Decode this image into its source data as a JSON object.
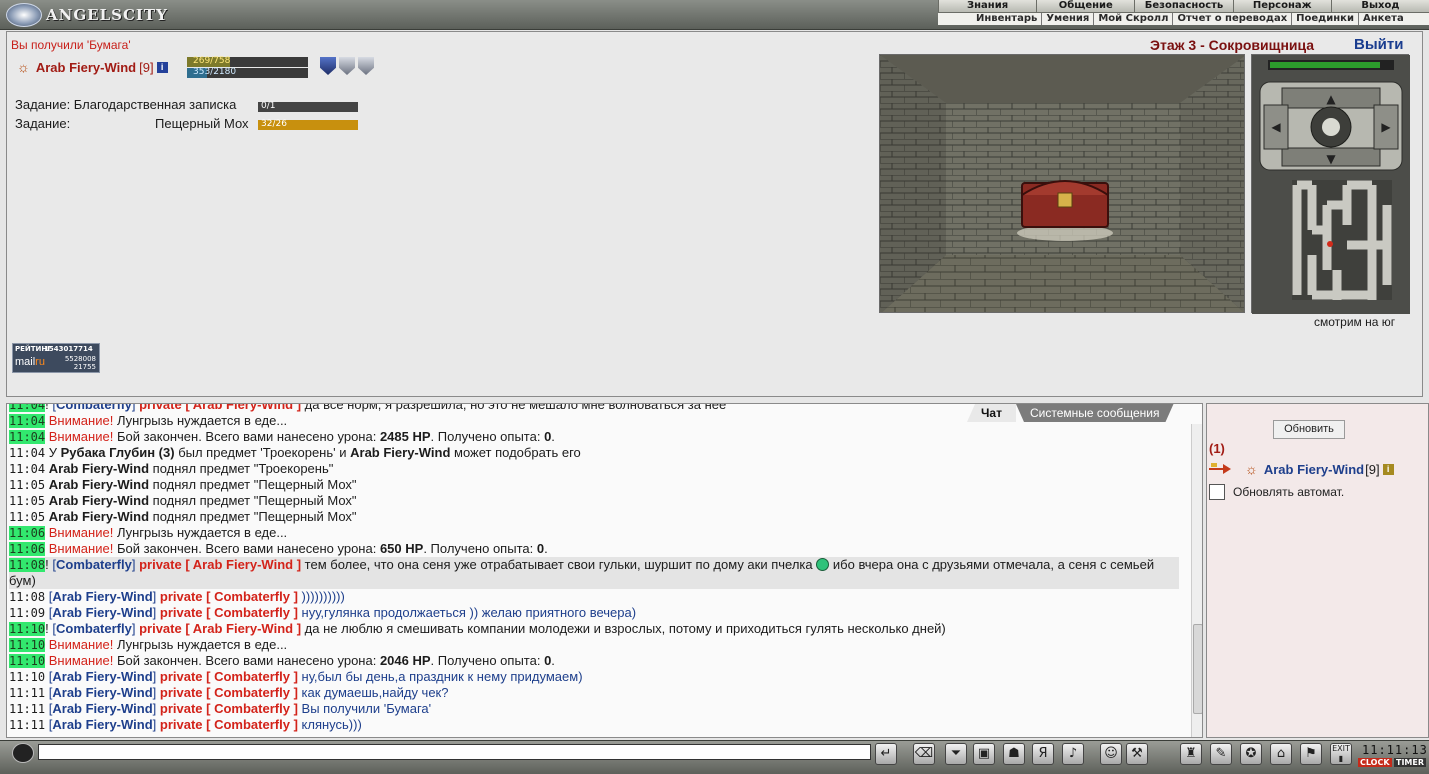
{
  "topbar": {
    "logo_text": "ANGELSCITY",
    "menu": [
      "Знания",
      "Общение",
      "Безопасность",
      "Персонаж",
      "Выход"
    ],
    "submenu": [
      "Инвентарь",
      "Умения",
      "Мой Скролл",
      "Отчет о переводах",
      "Поединки",
      "Анкета"
    ]
  },
  "main": {
    "got_message": "Вы получили 'Бумага'",
    "player": {
      "name": "Arab Fiery-Wind",
      "level": "[9]"
    },
    "hp": {
      "text": "269/758",
      "fraction": 0.355
    },
    "mp": {
      "text": "353/2180",
      "fraction": 0.162
    },
    "quest1": {
      "label": "Задание: Благодарственная записка",
      "progress_text": "0/1",
      "fraction": 0
    },
    "quest2": {
      "label": "Задание:",
      "item": "Пещерный Мох",
      "progress_text": "32/26",
      "fraction": 1
    },
    "floor": "Этаж 3 - Сокровищница",
    "exit": "Выйти",
    "looking": "смотрим на юг",
    "rating": {
      "label": "РЕЙТИНГ",
      "number": "1543017714",
      "brand_mail": "mail",
      "brand_ru": "ru",
      "stat1": "5528008",
      "stat2": "21755"
    }
  },
  "chat": {
    "tabs": [
      "Чат",
      "Системные сообщения"
    ],
    "lines": [
      {
        "time": "11:04",
        "green": true,
        "kind": "pm",
        "from": "Combaterfly",
        "to": "Arab Fiery-Wind",
        "text": "да все норм, я разрешила, но это не мешало мне волноваться за нее"
      },
      {
        "time": "11:04",
        "green": true,
        "kind": "warn",
        "prefix": "Внимание!",
        "text": "Лунгрызь нуждается в еде..."
      },
      {
        "time": "11:04",
        "green": true,
        "kind": "battle",
        "prefix": "Внимание!",
        "text1": "Бой закончен. Всего вами нанесено урона:",
        "dmg": "2485 HP",
        "text2": ". Получено опыта:",
        "exp": "0",
        "text3": "."
      },
      {
        "time": "11:04",
        "green": false,
        "kind": "drop",
        "text0": "У",
        "mob": "Рубака Глубин (3)",
        "text1": "был предмет 'Троекорень' и",
        "who": "Arab Fiery-Wind",
        "text2": "может подобрать его"
      },
      {
        "time": "11:04",
        "green": false,
        "kind": "pick",
        "who": "Arab Fiery-Wind",
        "text": "поднял предмет \"Троекорень\""
      },
      {
        "time": "11:05",
        "green": false,
        "kind": "pick",
        "who": "Arab Fiery-Wind",
        "text": "поднял предмет \"Пещерный Мох\""
      },
      {
        "time": "11:05",
        "green": false,
        "kind": "pick",
        "who": "Arab Fiery-Wind",
        "text": "поднял предмет \"Пещерный Мох\""
      },
      {
        "time": "11:05",
        "green": false,
        "kind": "pick",
        "who": "Arab Fiery-Wind",
        "text": "поднял предмет \"Пещерный Мох\""
      },
      {
        "time": "11:06",
        "green": true,
        "kind": "warn",
        "prefix": "Внимание!",
        "text": "Лунгрызь нуждается в еде..."
      },
      {
        "time": "11:06",
        "green": true,
        "kind": "battle",
        "prefix": "Внимание!",
        "text1": "Бой закончен. Всего вами нанесено урона:",
        "dmg": "650 HP",
        "text2": ". Получено опыта:",
        "exp": "0",
        "text3": "."
      },
      {
        "time": "11:08",
        "green": true,
        "kind": "pm_long",
        "from": "Combaterfly",
        "to": "Arab Fiery-Wind",
        "text1": "тем более, что она сеня уже отрабатывает свои гульки, шуршит по дому аки пчелка",
        "text2": "ибо вчера она с друзьями отмечала, а сеня с семьей бум)"
      },
      {
        "time": "11:08",
        "green": false,
        "kind": "pm",
        "from": "Arab Fiery-Wind",
        "to": "Combaterfly",
        "text": "))))))))))"
      },
      {
        "time": "11:09",
        "green": false,
        "kind": "pm",
        "from": "Arab Fiery-Wind",
        "to": "Combaterfly",
        "text": "нуу,гулянка продолжаеться )) желаю приятного вечера)"
      },
      {
        "time": "11:10",
        "green": true,
        "kind": "pm",
        "from": "Combaterfly",
        "to": "Arab Fiery-Wind",
        "text": "да не люблю я смешивать компании молодежи и взрослых, потому и приходиться гулять несколько дней)"
      },
      {
        "time": "11:10",
        "green": true,
        "kind": "warn",
        "prefix": "Внимание!",
        "text": "Лунгрызь нуждается в еде..."
      },
      {
        "time": "11:10",
        "green": true,
        "kind": "battle",
        "prefix": "Внимание!",
        "text1": "Бой закончен. Всего вами нанесено урона:",
        "dmg": "2046 HP",
        "text2": ". Получено опыта:",
        "exp": "0",
        "text3": "."
      },
      {
        "time": "11:10",
        "green": false,
        "kind": "pm",
        "from": "Arab Fiery-Wind",
        "to": "Combaterfly",
        "text": "ну,был бы день,а праздник к нему придумаем)"
      },
      {
        "time": "11:11",
        "green": false,
        "kind": "pm",
        "from": "Arab Fiery-Wind",
        "to": "Combaterfly",
        "text": "как думаешь,найду чек?"
      },
      {
        "time": "11:11",
        "green": false,
        "kind": "pm",
        "from": "Arab Fiery-Wind",
        "to": "Combaterfly",
        "text": "Вы получили 'Бумага'"
      },
      {
        "time": "11:11",
        "green": false,
        "kind": "pm",
        "from": "Arab Fiery-Wind",
        "to": "Combaterfly",
        "text": "клянусь)))"
      }
    ]
  },
  "online": {
    "refresh_label": "Обновить",
    "count": "(1)",
    "user_name": "Arab Fiery-Wind",
    "user_level": "[9]",
    "autoupdate_label": "Обновлять автомат."
  },
  "bottombar": {
    "clock": "11:11:13",
    "clock_label": "CLOCK",
    "timer_label": "TIMER",
    "exit_label": "EXIT"
  },
  "colors": {
    "warn_red": "#d3231a",
    "name_blue": "#1e3f8c",
    "time_green": "#32e86e",
    "quest_bar": "#c8900e"
  }
}
